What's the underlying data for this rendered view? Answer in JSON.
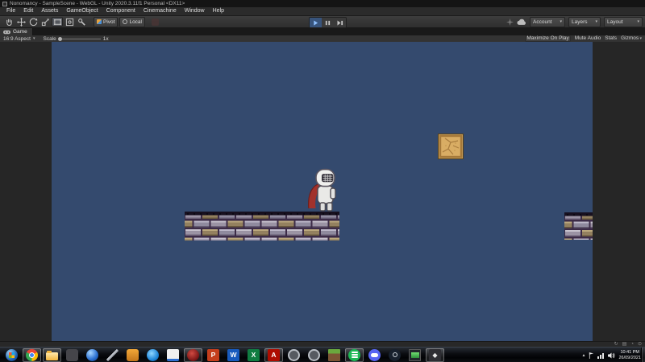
{
  "window": {
    "title": "Nonomancy - SampleScene - WebGL - Unity 2020.3.11f1 Personal <DX11>"
  },
  "menu_bar": {
    "items": [
      "File",
      "Edit",
      "Assets",
      "GameObject",
      "Component",
      "Cinemachine",
      "Window",
      "Help"
    ]
  },
  "toolbar": {
    "tools": [
      "hand-tool",
      "move-tool",
      "rotate-tool",
      "scale-tool",
      "rect-tool",
      "transform-tool",
      "custom-tool"
    ],
    "active_tool_index": 4,
    "pivot_label": "Pivot",
    "local_label": "Local",
    "account_label": "Account",
    "layers_label": "Layers",
    "layout_label": "Layout",
    "playback": {
      "play_active": true
    }
  },
  "game_view": {
    "tab_label": "Game",
    "aspect_label": "16:9 Aspect",
    "scale_label": "Scale",
    "scale_value": "1x",
    "maximize_on_play": "Maximize On Play",
    "mute_audio": "Mute Audio",
    "stats": "Stats",
    "gizmos": "Gizmos"
  },
  "scene": {
    "background_color": "#344a6e",
    "objects": [
      "knight-player",
      "stone-crate",
      "brick-platform-main",
      "brick-platform-right"
    ]
  },
  "status_bar": {
    "icons": [
      "activity-icon",
      "package-icon",
      "console-icon",
      "progress-icon"
    ]
  },
  "taskbar": {
    "icons": [
      {
        "name": "windows-start",
        "active": false
      },
      {
        "name": "chrome",
        "active": true
      },
      {
        "name": "explorer",
        "active": true
      },
      {
        "name": "dark-app",
        "active": false
      },
      {
        "name": "blue-orb-app",
        "active": false
      },
      {
        "name": "pen-app",
        "active": false
      },
      {
        "name": "satchel-app",
        "active": false
      },
      {
        "name": "blue-badge-app",
        "active": false
      },
      {
        "name": "editor-app",
        "active": false
      },
      {
        "name": "record-app",
        "active": true
      },
      {
        "name": "powerpoint",
        "glyph": "P",
        "active": false
      },
      {
        "name": "word",
        "glyph": "W",
        "active": false
      },
      {
        "name": "excel",
        "glyph": "X",
        "active": false
      },
      {
        "name": "acrobat",
        "glyph": "A",
        "active": true
      },
      {
        "name": "round-app-1",
        "active": false
      },
      {
        "name": "round-app-2",
        "active": false
      },
      {
        "name": "minecraft",
        "active": false
      },
      {
        "name": "spotify",
        "active": true
      },
      {
        "name": "discord",
        "active": false
      },
      {
        "name": "steam",
        "active": false
      },
      {
        "name": "monitor-app",
        "active": false
      },
      {
        "name": "unity-editor",
        "active": true
      }
    ],
    "tray": {
      "time": "10:41 PM",
      "date": "26/09/2021"
    }
  },
  "colors": {
    "scene_blue": "#344a6e",
    "editor_gray": "#262626",
    "play_highlight": "#38547c",
    "taskbar_bg": "#0a0c10",
    "brick_mortar": "#3c2b47",
    "crate_tan": "#d9ad64",
    "cape_red": "#a1322c"
  }
}
